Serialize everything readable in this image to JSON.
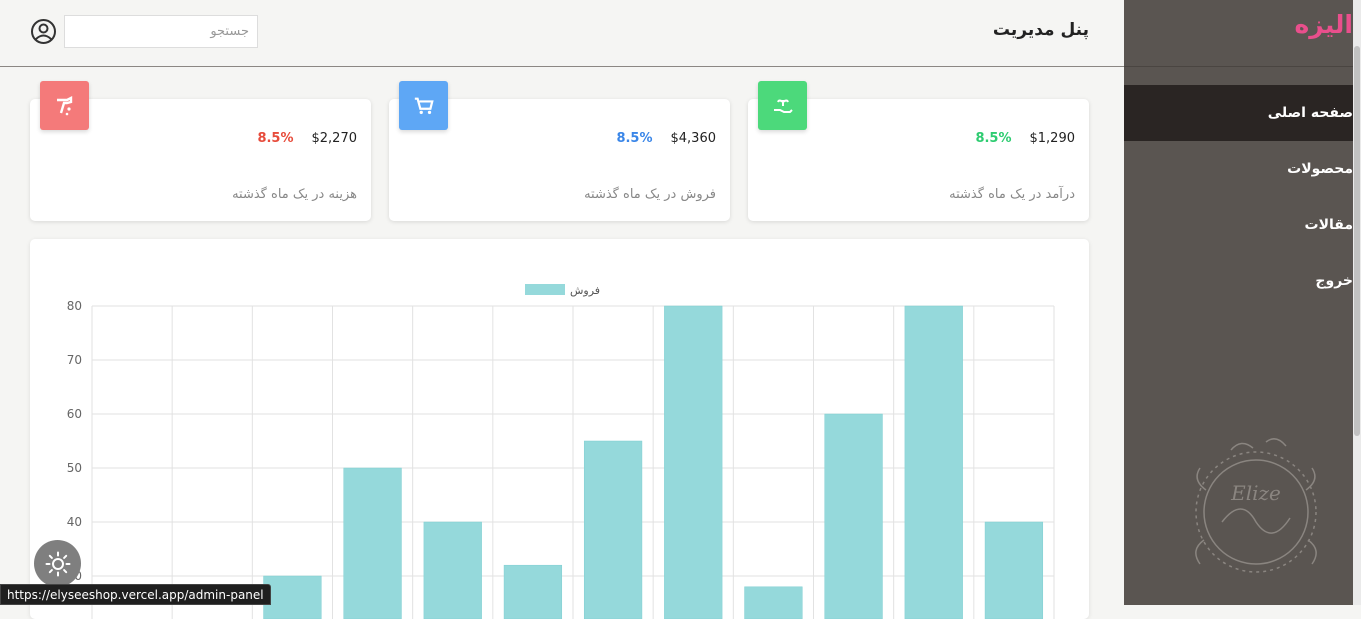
{
  "brand": {
    "name": "الیزه",
    "color": "#e94f8c",
    "logo_text": "Elize"
  },
  "header": {
    "title": "پنل مدیریت",
    "search": {
      "placeholder": "جستجو",
      "value": ""
    },
    "user_icon": "user-circle-icon"
  },
  "sidebar": {
    "items": [
      {
        "label": "صفحه اصلی",
        "active": true
      },
      {
        "label": "محصولات",
        "active": false
      },
      {
        "label": "مقالات",
        "active": false
      },
      {
        "label": "خروج",
        "active": false
      }
    ]
  },
  "cards": [
    {
      "amount": "$1,290",
      "percent": "8.5%",
      "caption": "درآمد در یک ماه گذشته",
      "color": "#2ecc71",
      "icon": "hand-plant-icon"
    },
    {
      "amount": "$4,360",
      "percent": "8.5%",
      "caption": "فروش در یک ماه گذشته",
      "color": "#3a86e8",
      "icon": "shopping-cart-icon"
    },
    {
      "amount": "$2,270",
      "percent": "8.5%",
      "caption": "هزینه در یک ماه گذشته",
      "color": "#e74c3c",
      "icon": "hand-coin-icon"
    }
  ],
  "card_icon_bg": [
    "#4cd97b",
    "#5ea7f5",
    "#f47a7a"
  ],
  "chart_data": {
    "type": "bar",
    "series": [
      {
        "name": "فروش",
        "color": "#95d9db",
        "values": [
          null,
          null,
          30,
          50,
          40,
          32,
          55,
          80,
          28,
          60,
          80,
          40
        ]
      }
    ],
    "categories": [
      "",
      "",
      "",
      "",
      "",
      "",
      "",
      "",
      "",
      "",
      "",
      ""
    ],
    "ylim": [
      30,
      80
    ],
    "yticks": [
      30,
      40,
      50,
      60,
      70,
      80
    ],
    "grid": true,
    "legend_position": "top"
  },
  "status_bar": {
    "url": "https://elyseeshop.vercel.app/admin-panel"
  },
  "theme_toggle_icon": "sun-icon"
}
